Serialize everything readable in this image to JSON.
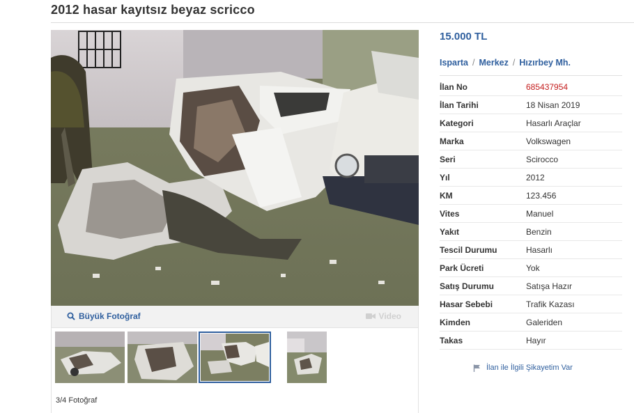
{
  "listing": {
    "title": "2012 hasar kayıtsız beyaz scricco",
    "price": "15.000 TL"
  },
  "location": {
    "city": "Isparta",
    "district": "Merkez",
    "neighborhood": "Hızırbey Mh.",
    "separator": "/"
  },
  "details": [
    {
      "key": "İlan No",
      "value": "685437954"
    },
    {
      "key": "İlan Tarihi",
      "value": "18 Nisan 2019"
    },
    {
      "key": "Kategori",
      "value": "Hasarlı Araçlar"
    },
    {
      "key": "Marka",
      "value": "Volkswagen"
    },
    {
      "key": "Seri",
      "value": "Scirocco"
    },
    {
      "key": "Yıl",
      "value": "2012"
    },
    {
      "key": "KM",
      "value": "123.456"
    },
    {
      "key": "Vites",
      "value": "Manuel"
    },
    {
      "key": "Yakıt",
      "value": "Benzin"
    },
    {
      "key": "Tescil Durumu",
      "value": "Hasarlı"
    },
    {
      "key": "Park Ücreti",
      "value": "Yok"
    },
    {
      "key": "Satış Durumu",
      "value": "Satışa Hazır"
    },
    {
      "key": "Hasar Sebebi",
      "value": "Trafik Kazası"
    },
    {
      "key": "Kimden",
      "value": "Galeriden"
    },
    {
      "key": "Takas",
      "value": "Hayır"
    }
  ],
  "gallery": {
    "big_photo_label": "Büyük Fotoğraf",
    "video_label": "Video",
    "counter": "3/4 Fotoğraf",
    "selected_index": 3,
    "thumb_count": 4
  },
  "complaint_label": "İlan ile İlgili Şikayetim Var",
  "icons": {
    "magnifier": "search-icon",
    "camera": "video-camera-icon",
    "flag": "flag-icon"
  },
  "colors": {
    "link": "#2f5f9e",
    "listing_no": "#c41d1d",
    "video_disabled": "#d0d0d0"
  }
}
